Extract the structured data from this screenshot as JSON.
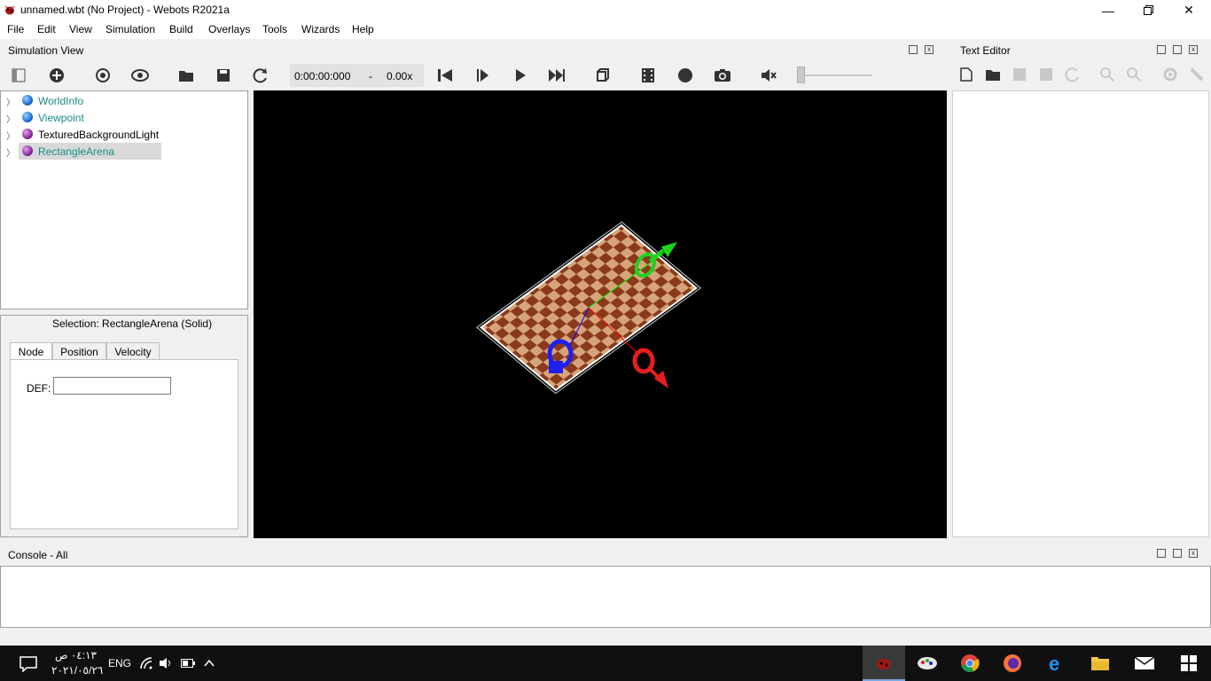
{
  "window": {
    "title": "unnamed.wbt (No Project) - Webots R2021a"
  },
  "menu": [
    "File",
    "Edit",
    "View",
    "Simulation",
    "Build",
    "Overlays",
    "Tools",
    "Wizards",
    "Help"
  ],
  "simulation_view": {
    "title": "Simulation View",
    "time": "0:00:00:000",
    "separator": "-",
    "speed": "0.00x"
  },
  "scene_tree": {
    "items": [
      {
        "label": "WorldInfo",
        "color": "#1a6fd6",
        "text_color": "#1a8a8a"
      },
      {
        "label": "Viewpoint",
        "color": "#1a6fd6",
        "text_color": "#1a8a8a"
      },
      {
        "label": "TexturedBackgroundLight",
        "color": "#8a2a9a",
        "text_color": "#000000"
      },
      {
        "label": "RectangleArena",
        "color": "#8a2a9a",
        "text_color": "#1a8a8a"
      }
    ]
  },
  "selection": {
    "label": "Selection: RectangleArena (Solid)",
    "tabs": [
      "Node",
      "Position",
      "Velocity"
    ],
    "def_label": "DEF:",
    "def_value": ""
  },
  "text_editor": {
    "title": "Text Editor"
  },
  "console": {
    "title": "Console - All"
  },
  "taskbar": {
    "time": "٠٤:١٣ ص",
    "date": "٢٠٢١/٠٥/٢٦",
    "lang": "ENG"
  },
  "icons": {
    "tree_toggle": "panel-toggle-icon",
    "add": "add-node-icon",
    "reset_view": "reset-viewpoint-icon",
    "view": "eye-icon",
    "open": "folder-open-icon",
    "save": "save-icon",
    "reload": "reload-icon",
    "step_back": "reset-simulation-icon",
    "step": "step-icon",
    "run": "play-icon",
    "fast": "fast-forward-icon",
    "cube": "cube-icon",
    "movie": "movie-icon",
    "record": "record-icon",
    "camera": "camera-icon",
    "mute": "speaker-mute-icon"
  }
}
